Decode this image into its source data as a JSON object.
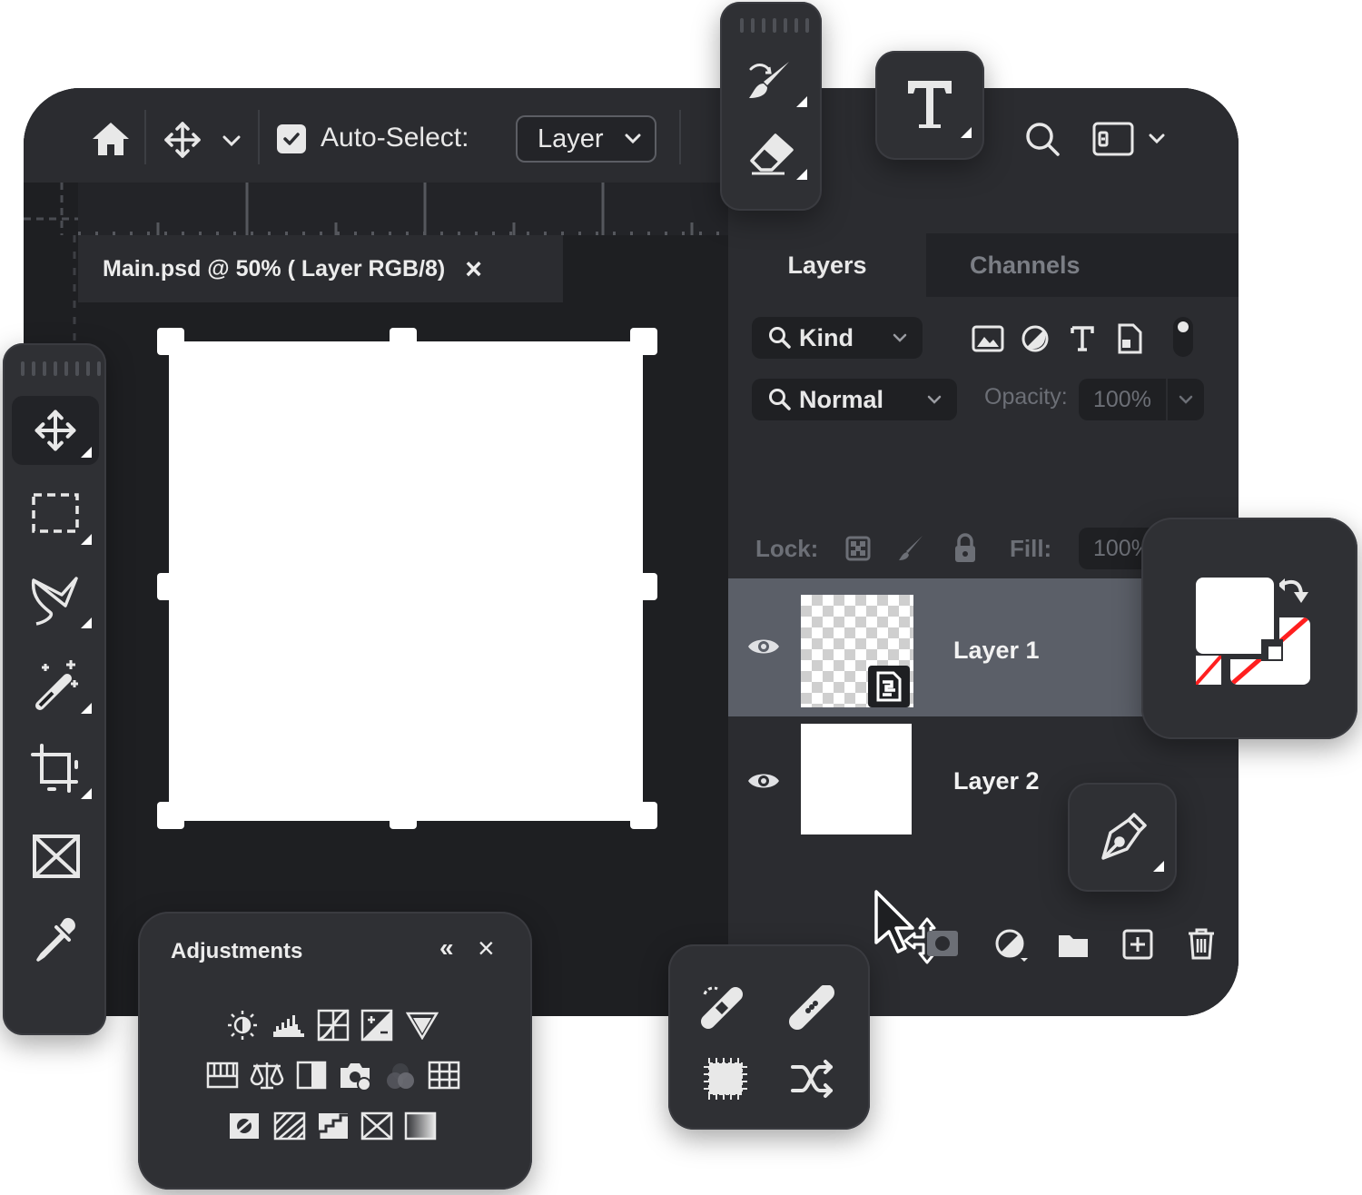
{
  "options_bar": {
    "auto_select_label": "Auto-Select:",
    "auto_select_checked": true,
    "auto_select_dropdown": "Layer"
  },
  "document": {
    "tab_title": "Main.psd @ 50% ( Layer RGB/8)",
    "close_glyph": "×"
  },
  "layers_panel": {
    "tabs": [
      "Layers",
      "Channels"
    ],
    "active_tab": "Layers",
    "filter_kind": "Kind",
    "blend_mode": "Normal",
    "opacity_label": "Opacity:",
    "opacity_value": "100%",
    "lock_label": "Lock:",
    "fill_label": "Fill:",
    "fill_value": "100%",
    "layers": [
      {
        "name": "Layer 1",
        "visible": true,
        "selected": true,
        "thumbnail": "transparent-smart-object"
      },
      {
        "name": "Layer 2",
        "visible": true,
        "selected": false,
        "thumbnail": "white-fill"
      }
    ]
  },
  "adjustments_panel": {
    "title": "Adjustments",
    "collapse_glyph": "«",
    "close_glyph": "×"
  },
  "colors": {
    "window_bg": "#1e1f22",
    "panel_bg": "#2b2c30",
    "selected_layer_bg": "#5b5f68",
    "accent_red": "#ff1f1f"
  },
  "icons": {
    "options_bar": [
      "home-icon",
      "move-icon",
      "chevron-down-icon",
      "checkbox-icon",
      "search-icon",
      "workspace-icon"
    ],
    "left_toolbar": [
      "move-tool-icon",
      "marquee-tool-icon",
      "lasso-tool-icon",
      "magic-wand-icon",
      "crop-tool-icon",
      "frame-tool-icon",
      "eyedropper-icon"
    ],
    "floating_tools": [
      "brush-tool-icon",
      "eraser-tool-icon",
      "type-tool-icon",
      "pen-tool-icon",
      "select-move-cursor-icon",
      "swap-colors-icon"
    ],
    "layer_footer": [
      "add-mask-icon",
      "adjustment-layer-icon",
      "group-folder-icon",
      "new-layer-icon",
      "delete-layer-icon"
    ],
    "healing_tools": [
      "spot-healing-icon",
      "healing-brush-icon",
      "patch-tool-icon",
      "content-aware-move-icon"
    ]
  }
}
